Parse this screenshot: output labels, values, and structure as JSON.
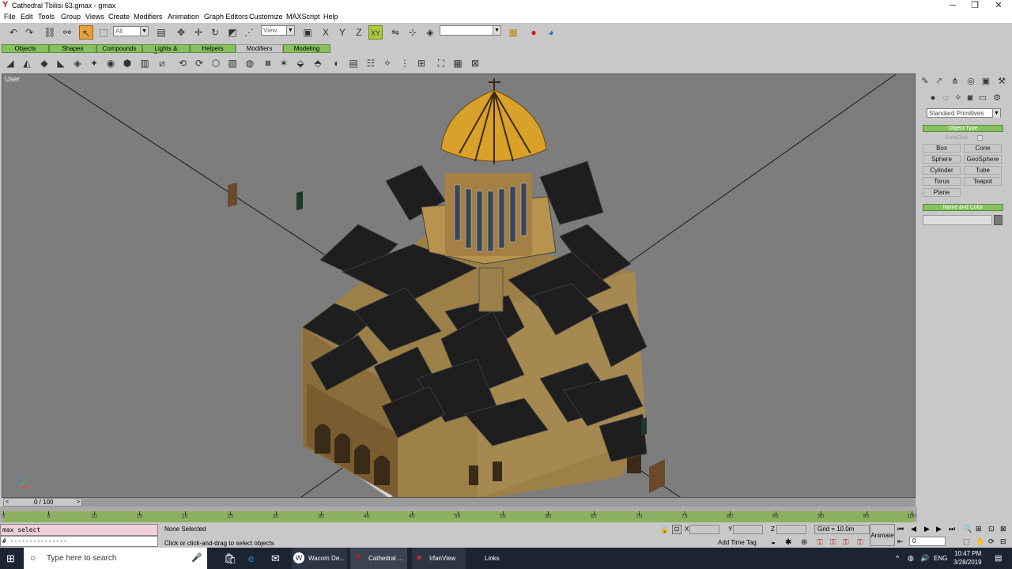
{
  "window": {
    "title": "Cathedral Tbilisi 63.gmax - gmax",
    "minimize": "─",
    "maximize": "❐",
    "close": "✕"
  },
  "menu": [
    "File",
    "Edit",
    "Tools",
    "Group",
    "Views",
    "Create",
    "Modifiers",
    "Animation",
    "Graph Editors",
    "Customize",
    "MAXScript",
    "Help"
  ],
  "toolbar": {
    "selection_filter": "All",
    "reference_coord": "View",
    "axis_xy": "XY",
    "named_selection": ""
  },
  "tabs": [
    "Objects",
    "Shapes",
    "Compounds",
    "Lights & Cameras",
    "Helpers",
    "Modifiers",
    "Modeling"
  ],
  "active_tab": "Modifiers",
  "viewport": {
    "label": "User"
  },
  "command_panel": {
    "category_dropdown": "Standard Primitives",
    "object_type_header": "Object Type",
    "autogrid_label": "AutoGrid",
    "buttons": [
      "Box",
      "Cone",
      "Sphere",
      "GeoSphere",
      "Cylinder",
      "Tube",
      "Torus",
      "Teapot",
      "Plane"
    ],
    "name_color_header": "Name and Color",
    "name_value": ""
  },
  "timeline": {
    "frame_display": "0 / 100",
    "ruler_ticks": [
      "0",
      "5",
      "10",
      "15",
      "20",
      "25",
      "30",
      "35",
      "40",
      "45",
      "50",
      "55",
      "60",
      "65",
      "70",
      "75",
      "80",
      "85",
      "90",
      "95",
      "100"
    ]
  },
  "status": {
    "maxscript_line1": "max select",
    "maxscript_line2": "# ---------------",
    "selection": "None Selected",
    "prompt": "Click or click-and-drag to select objects",
    "x_label": "X",
    "y_label": "Y",
    "z_label": "Z",
    "grid": "Grid = 10.0m",
    "add_time_tag": "Add Time Tag",
    "animate": "Animate",
    "frame_field": "0"
  },
  "taskbar": {
    "search_placeholder": "Type here to search",
    "apps": [
      "Wacom De...",
      "Cathedral ...",
      "IrfanView",
      "Links"
    ],
    "language": "ENG",
    "time": "10:47 PM",
    "date": "3/28/2019"
  },
  "colors": {
    "viewport_bg": "#7d7d7d",
    "tab_green": "#88c060",
    "roof_dark": "#1e1e1e",
    "wall_tan": "#9c8048",
    "dome_gold": "#d9a02a"
  }
}
